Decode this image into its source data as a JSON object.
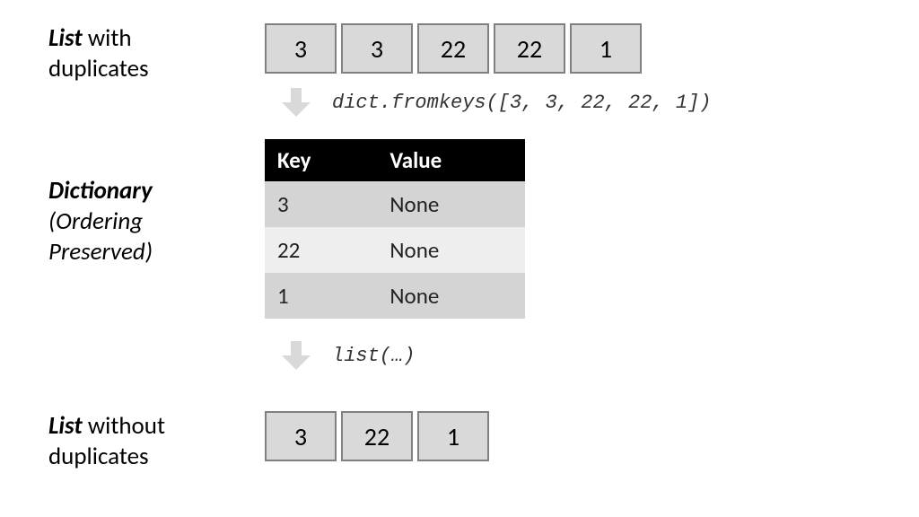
{
  "labels": {
    "list_with": {
      "strong": "List ",
      "rest": "with duplicates"
    },
    "dict": {
      "strong": "Dictionary",
      "rest": "(Ordering Preserved)"
    },
    "list_without": {
      "strong": "List ",
      "rest": "without duplicates"
    }
  },
  "code": {
    "fromkeys": "dict.fromkeys([3, 3, 22, 22, 1])",
    "list": "list(…)"
  },
  "input_list": [
    "3",
    "3",
    "22",
    "22",
    "1"
  ],
  "output_list": [
    "3",
    "22",
    "1"
  ],
  "dict_table": {
    "headers": {
      "key": "Key",
      "value": "Value"
    },
    "rows": [
      {
        "key": "3",
        "value": "None"
      },
      {
        "key": "22",
        "value": "None"
      },
      {
        "key": "1",
        "value": "None"
      }
    ]
  },
  "chart_data": {
    "type": "table",
    "title": "Removing duplicates from a list using dict.fromkeys (ordering preserved)",
    "input": [
      3,
      3,
      22,
      22,
      1
    ],
    "dictionary": [
      {
        "key": 3,
        "value": null
      },
      {
        "key": 22,
        "value": null
      },
      {
        "key": 1,
        "value": null
      }
    ],
    "output": [
      3,
      22,
      1
    ],
    "steps": [
      "dict.fromkeys([3, 3, 22, 22, 1])",
      "list(…)"
    ]
  }
}
